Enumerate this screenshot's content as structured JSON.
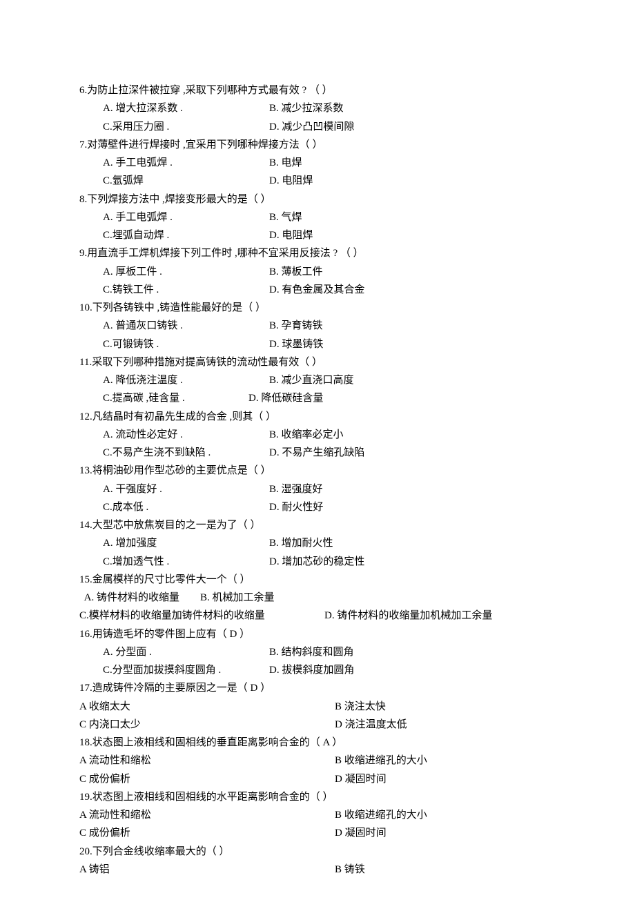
{
  "questions": [
    {
      "num": "6",
      "text": "为防止拉深件被拉穿    ,采取下列哪种方式最有效    ? （            ）",
      "opts": {
        "A": "A. 增大拉深系数  .",
        "B": "B. 减少拉深系数",
        "C": "C.采用压力圈  .",
        "D": "D. 减少凸凹模间隙"
      }
    },
    {
      "num": "7",
      "text": "对薄壁件进行焊接时    ,宜采用下列哪种焊接方法（            ）",
      "opts": {
        "A": "A. 手工电弧焊  .",
        "B": "B. 电焊",
        "C": "C.氩弧焊",
        "D": "D. 电阻焊"
      }
    },
    {
      "num": "8",
      "text": "下列焊接方法中   ,焊接变形最大的是（         ）",
      "opts": {
        "A": "A. 手工电弧焊  .",
        "B": "B. 气焊",
        "C": "C.埋弧自动焊  .",
        "D": "D. 电阻焊"
      }
    },
    {
      "num": "9",
      "text": "用直流手工焊机焊接下列工件时      ,哪种不宜采用反接法    ? （      ）",
      "opts": {
        "A": "A. 厚板工件  .",
        "B": "B. 薄板工件",
        "C": "C.铸铁工件  .",
        "D": "D. 有色金属及其合金"
      }
    },
    {
      "num": "10",
      "text": "下列各铸铁中  ,铸造性能最好的是（          ）",
      "opts": {
        "A": "A. 普通灰口铸铁  .",
        "B": "B. 孕育铸铁",
        "C": "C.可锻铸铁  .",
        "D": "D. 球墨铸铁"
      }
    },
    {
      "num": "11",
      "text": "采取下列哪种措施对提高铸铁的流动性最有效（              ）",
      "opts": {
        "A": "A. 降低浇注温度  .",
        "B": "B. 减少直浇口高度",
        "C": "C.提高碳  ,硅含量 .",
        "D": "D. 降低碳硅含量"
      }
    },
    {
      "num": "12",
      "text": "凡结晶时有初晶先生成的合金    ,则其（         ）",
      "opts": {
        "A": "A. 流动性必定好  .",
        "B": "B. 收缩率必定小",
        "C": "C.不易产生浇不到缺陷    .",
        "D": "D. 不易产生缩孔缺陷"
      }
    },
    {
      "num": "13",
      "text": "将桐油砂用作型芯砂的主要优点是（           ）",
      "opts": {
        "A": "A. 干强度好  .",
        "B": "B. 湿强度好",
        "C": "C.成本低  .",
        "D": "D. 耐火性好"
      }
    },
    {
      "num": "14",
      "text": "大型芯中放焦炭目的之一是为了（            ）",
      "opts": {
        "A": "A. 增加强度",
        "B": "B. 增加耐火性",
        "C": "C.增加透气性  .",
        "D": "D. 增加芯砂的稳定性"
      }
    },
    {
      "num": "15",
      "text": "金属模样的尺寸比零件大一个（           ）",
      "line1": "  A. 铸件材料的收缩量        B. 机械加工余量",
      "line2_a": "C.模样材料的收缩量加铸件材料的收缩量",
      "line2_b": "D. 铸件材料的收缩量加机械加工余量"
    },
    {
      "num": "16",
      "text": "用铸造毛坏的零件图上应有（      D      ）",
      "opts": {
        "A": "A. 分型面  .",
        "B": "B. 结构斜度和圆角",
        "C": "C.分型面加拔摸斜度圆角    .",
        "D": "D. 拔模斜度加圆角"
      }
    },
    {
      "num": "17",
      "text": "造成铸件冷隔的主要原因之一是（       D      ）",
      "opts": {
        "A": "A 收缩太大",
        "B": "B 浇注太快",
        "C": "C 内浇口太少",
        "D": "D 浇注温度太低"
      }
    },
    {
      "num": "18",
      "text": "状态图上液相线和固相线的垂直距离影响合金的（        A      ）",
      "opts": {
        "A": "A 流动性和缩松",
        "B": "B 收缩进缩孔的大小",
        "C": "C 成份偏析",
        "D": "D 凝固时间"
      }
    },
    {
      "num": "19",
      "text": "状态图上液相线和固相线的水平距离影响合金的（              ）",
      "opts": {
        "A": "A 流动性和缩松",
        "B": "B 收缩进缩孔的大小",
        "C": "C 成份偏析",
        "D": "D 凝固时间"
      }
    },
    {
      "num": "20",
      "text": "下列合金线收缩率最大的（            ）",
      "opts": {
        "A": "A 铸铝",
        "B": "B 铸铁"
      }
    }
  ]
}
